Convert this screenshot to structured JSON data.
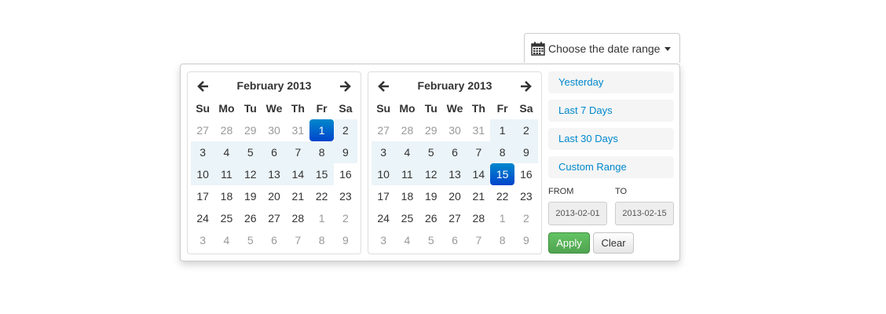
{
  "trigger": {
    "label": "Choose the date range",
    "icon": "calendar-icon"
  },
  "weekdays": [
    "Su",
    "Mo",
    "Tu",
    "We",
    "Th",
    "Fr",
    "Sa"
  ],
  "calendars": [
    {
      "month_label": "February 2013",
      "rows": [
        [
          {
            "d": "27",
            "off": true
          },
          {
            "d": "28",
            "off": true
          },
          {
            "d": "29",
            "off": true
          },
          {
            "d": "30",
            "off": true
          },
          {
            "d": "31",
            "off": true
          },
          {
            "d": "1",
            "active": true
          },
          {
            "d": "2",
            "inrange": true
          }
        ],
        [
          {
            "d": "3",
            "inrange": true
          },
          {
            "d": "4",
            "inrange": true
          },
          {
            "d": "5",
            "inrange": true
          },
          {
            "d": "6",
            "inrange": true
          },
          {
            "d": "7",
            "inrange": true
          },
          {
            "d": "8",
            "inrange": true
          },
          {
            "d": "9",
            "inrange": true
          }
        ],
        [
          {
            "d": "10",
            "inrange": true
          },
          {
            "d": "11",
            "inrange": true
          },
          {
            "d": "12",
            "inrange": true
          },
          {
            "d": "13",
            "inrange": true
          },
          {
            "d": "14",
            "inrange": true
          },
          {
            "d": "15",
            "inrange": true
          },
          {
            "d": "16"
          }
        ],
        [
          {
            "d": "17"
          },
          {
            "d": "18"
          },
          {
            "d": "19"
          },
          {
            "d": "20"
          },
          {
            "d": "21"
          },
          {
            "d": "22"
          },
          {
            "d": "23"
          }
        ],
        [
          {
            "d": "24"
          },
          {
            "d": "25"
          },
          {
            "d": "26"
          },
          {
            "d": "27"
          },
          {
            "d": "28"
          },
          {
            "d": "1",
            "off": true
          },
          {
            "d": "2",
            "off": true
          }
        ],
        [
          {
            "d": "3",
            "off": true
          },
          {
            "d": "4",
            "off": true
          },
          {
            "d": "5",
            "off": true
          },
          {
            "d": "6",
            "off": true
          },
          {
            "d": "7",
            "off": true
          },
          {
            "d": "8",
            "off": true
          },
          {
            "d": "9",
            "off": true
          }
        ]
      ]
    },
    {
      "month_label": "February 2013",
      "rows": [
        [
          {
            "d": "27",
            "off": true
          },
          {
            "d": "28",
            "off": true
          },
          {
            "d": "29",
            "off": true
          },
          {
            "d": "30",
            "off": true
          },
          {
            "d": "31",
            "off": true
          },
          {
            "d": "1",
            "inrange": true
          },
          {
            "d": "2",
            "inrange": true
          }
        ],
        [
          {
            "d": "3",
            "inrange": true
          },
          {
            "d": "4",
            "inrange": true
          },
          {
            "d": "5",
            "inrange": true
          },
          {
            "d": "6",
            "inrange": true
          },
          {
            "d": "7",
            "inrange": true
          },
          {
            "d": "8",
            "inrange": true
          },
          {
            "d": "9",
            "inrange": true
          }
        ],
        [
          {
            "d": "10",
            "inrange": true
          },
          {
            "d": "11",
            "inrange": true
          },
          {
            "d": "12",
            "inrange": true
          },
          {
            "d": "13",
            "inrange": true
          },
          {
            "d": "14",
            "inrange": true
          },
          {
            "d": "15",
            "active": true
          },
          {
            "d": "16"
          }
        ],
        [
          {
            "d": "17"
          },
          {
            "d": "18"
          },
          {
            "d": "19"
          },
          {
            "d": "20"
          },
          {
            "d": "21"
          },
          {
            "d": "22"
          },
          {
            "d": "23"
          }
        ],
        [
          {
            "d": "24"
          },
          {
            "d": "25"
          },
          {
            "d": "26"
          },
          {
            "d": "27"
          },
          {
            "d": "28"
          },
          {
            "d": "1",
            "off": true
          },
          {
            "d": "2",
            "off": true
          }
        ],
        [
          {
            "d": "3",
            "off": true
          },
          {
            "d": "4",
            "off": true
          },
          {
            "d": "5",
            "off": true
          },
          {
            "d": "6",
            "off": true
          },
          {
            "d": "7",
            "off": true
          },
          {
            "d": "8",
            "off": true
          },
          {
            "d": "9",
            "off": true
          }
        ]
      ]
    }
  ],
  "ranges": [
    "Yesterday",
    "Last 7 Days",
    "Last 30 Days",
    "Custom Range"
  ],
  "inputs": {
    "from_label": "FROM",
    "to_label": "TO",
    "from_value": "2013-02-01",
    "to_value": "2013-02-15"
  },
  "buttons": {
    "apply": "Apply",
    "clear": "Clear"
  },
  "colors": {
    "active": "#0088cc",
    "in_range": "#ebf4f8",
    "link": "#0088cc",
    "apply": "#51a351"
  }
}
